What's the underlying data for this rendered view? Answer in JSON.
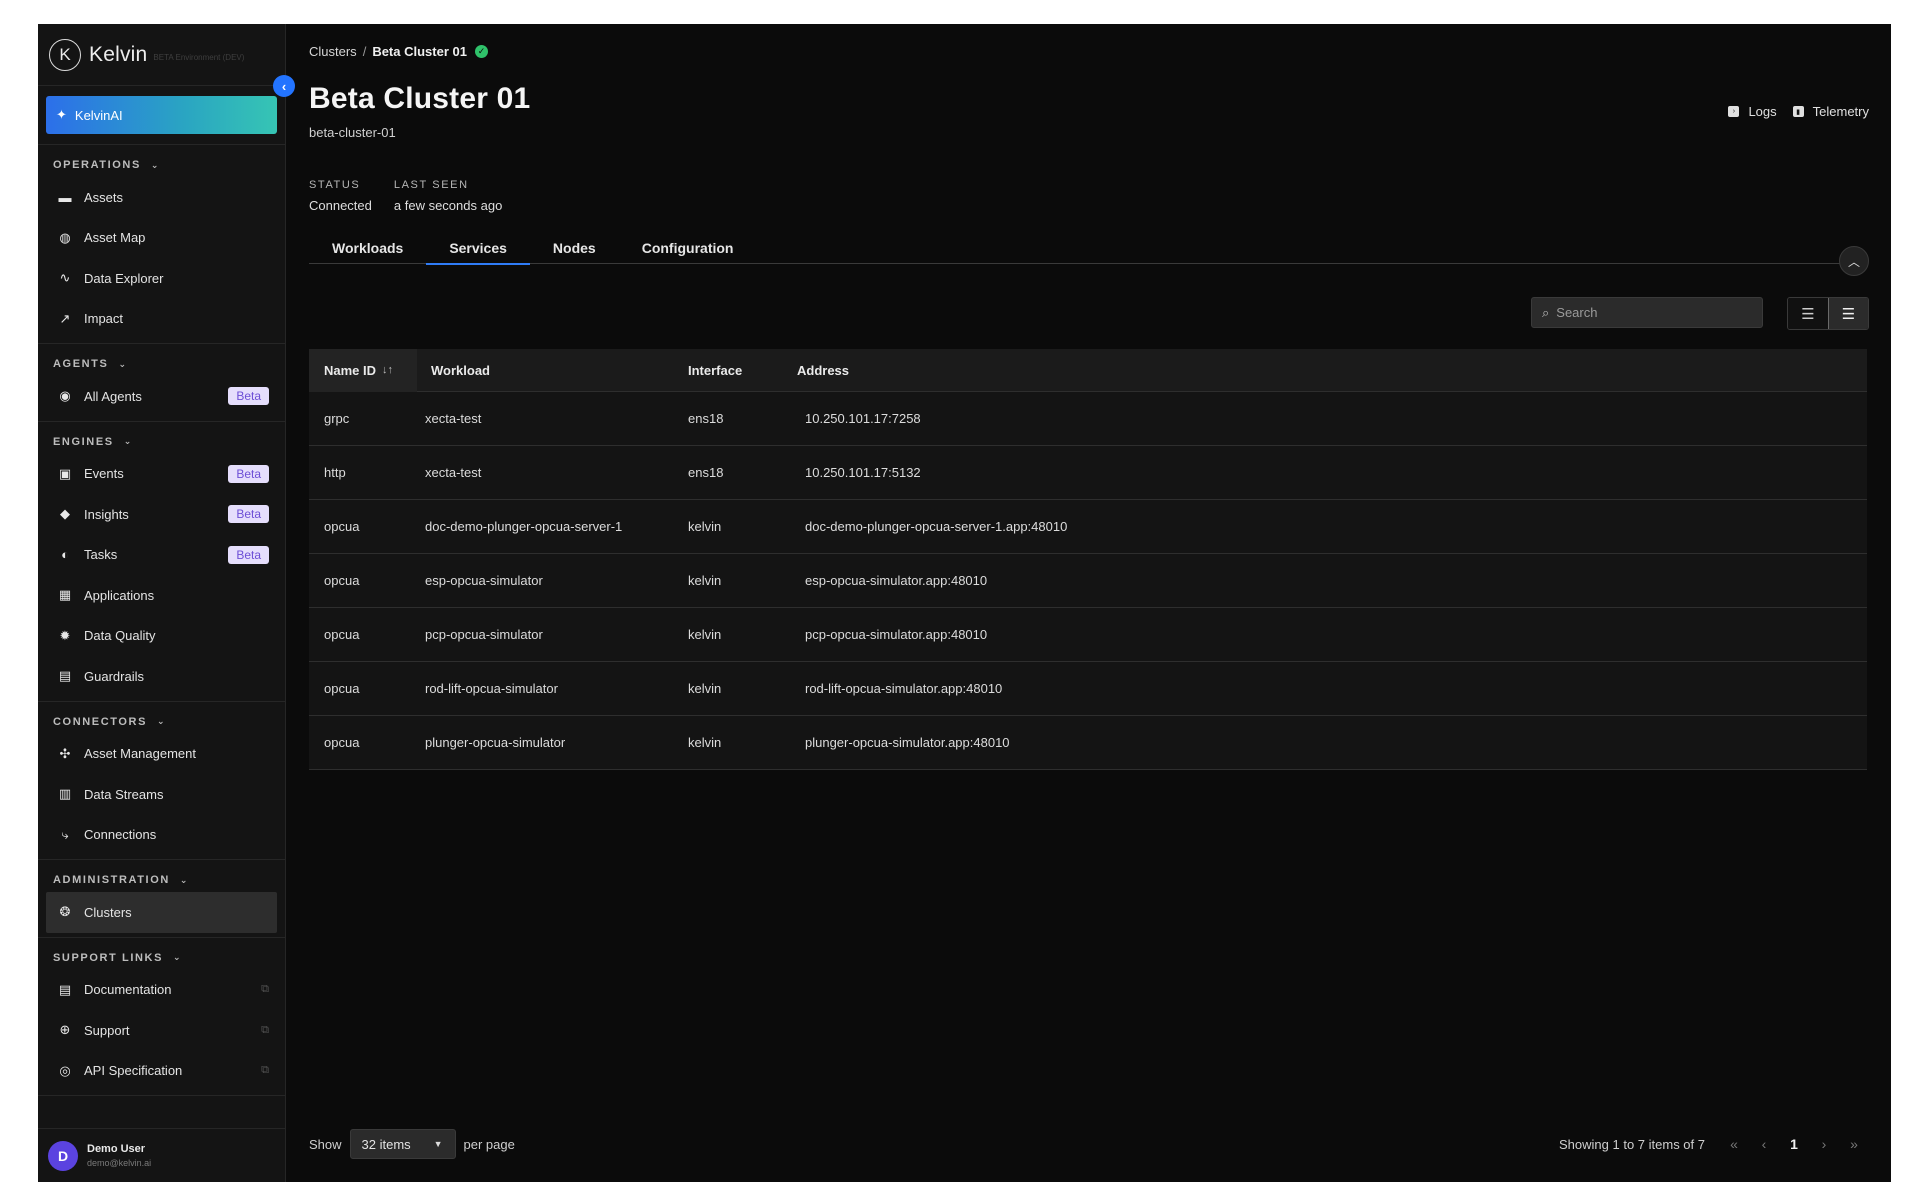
{
  "brand": {
    "logo_letter": "K",
    "name": "Kelvin",
    "env": "BETA Environment (DEV)"
  },
  "sidebar": {
    "ai_button": "KelvinAI",
    "sections": [
      {
        "title": "OPERATIONS",
        "items": [
          {
            "label": "Assets",
            "icon": "assets-icon"
          },
          {
            "label": "Asset Map",
            "icon": "globe-icon"
          },
          {
            "label": "Data Explorer",
            "icon": "pulse-icon"
          },
          {
            "label": "Impact",
            "icon": "trend-icon"
          }
        ]
      },
      {
        "title": "AGENTS",
        "items": [
          {
            "label": "All Agents",
            "icon": "agent-icon",
            "badge": "Beta"
          }
        ]
      },
      {
        "title": "ENGINES",
        "items": [
          {
            "label": "Events",
            "icon": "events-icon",
            "badge": "Beta"
          },
          {
            "label": "Insights",
            "icon": "tag-icon",
            "badge": "Beta"
          },
          {
            "label": "Tasks",
            "icon": "tasks-icon",
            "badge": "Beta"
          },
          {
            "label": "Applications",
            "icon": "apps-icon"
          },
          {
            "label": "Data Quality",
            "icon": "gear-icon"
          },
          {
            "label": "Guardrails",
            "icon": "barrier-icon"
          }
        ]
      },
      {
        "title": "CONNECTORS",
        "items": [
          {
            "label": "Asset Management",
            "icon": "asset-management-icon"
          },
          {
            "label": "Data Streams",
            "icon": "chart-icon"
          },
          {
            "label": "Connections",
            "icon": "connection-icon"
          }
        ]
      },
      {
        "title": "ADMINISTRATION",
        "items": [
          {
            "label": "Clusters",
            "icon": "cluster-icon",
            "active": true
          }
        ]
      },
      {
        "title": "SUPPORT LINKS",
        "items": [
          {
            "label": "Documentation",
            "icon": "document-icon",
            "external": true
          },
          {
            "label": "Support",
            "icon": "lifebuoy-icon",
            "external": true
          },
          {
            "label": "API Specification",
            "icon": "api-icon",
            "external": true
          }
        ]
      }
    ],
    "user": {
      "initial": "D",
      "name": "Demo User",
      "email": "demo@kelvin.ai"
    }
  },
  "header": {
    "breadcrumb": {
      "parent": "Clusters",
      "separator": "/",
      "current": "Beta Cluster 01"
    },
    "title": "Beta Cluster 01",
    "subtitle": "beta-cluster-01",
    "actions": {
      "logs": "Logs",
      "telemetry": "Telemetry"
    },
    "meta": {
      "status_label": "STATUS",
      "status_value": "Connected",
      "last_seen_label": "LAST SEEN",
      "last_seen_value": "a few seconds ago"
    }
  },
  "tabs": [
    {
      "label": "Workloads",
      "active": false
    },
    {
      "label": "Services",
      "active": true
    },
    {
      "label": "Nodes",
      "active": false
    },
    {
      "label": "Configuration",
      "active": false
    }
  ],
  "search": {
    "placeholder": "Search",
    "value": ""
  },
  "table": {
    "columns": [
      "Name ID",
      "Workload",
      "Interface",
      "Address"
    ],
    "rows": [
      [
        "grpc",
        "xecta-test",
        "ens18",
        "10.250.101.17:7258"
      ],
      [
        "http",
        "xecta-test",
        "ens18",
        "10.250.101.17:5132"
      ],
      [
        "opcua",
        "doc-demo-plunger-opcua-server-1",
        "kelvin",
        "doc-demo-plunger-opcua-server-1.app:48010"
      ],
      [
        "opcua",
        "esp-opcua-simulator",
        "kelvin",
        "esp-opcua-simulator.app:48010"
      ],
      [
        "opcua",
        "pcp-opcua-simulator",
        "kelvin",
        "pcp-opcua-simulator.app:48010"
      ],
      [
        "opcua",
        "rod-lift-opcua-simulator",
        "kelvin",
        "rod-lift-opcua-simulator.app:48010"
      ],
      [
        "opcua",
        "plunger-opcua-simulator",
        "kelvin",
        "plunger-opcua-simulator.app:48010"
      ]
    ]
  },
  "footer": {
    "show_label": "Show",
    "per_page_value": "32 items",
    "per_page_label": "per page",
    "showing": "Showing 1 to 7 items of 7",
    "current_page": "1"
  }
}
